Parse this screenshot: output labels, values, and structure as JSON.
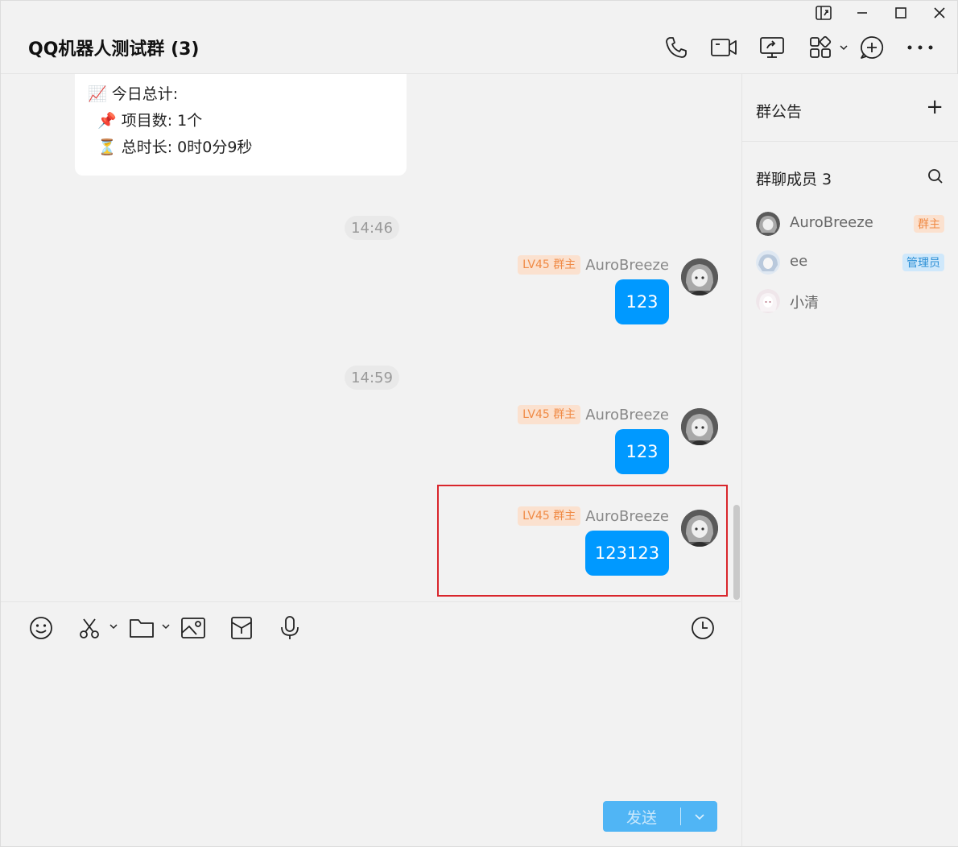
{
  "header": {
    "title": "QQ机器人测试群 (3)"
  },
  "chat": {
    "summary": {
      "line1_emoji": "📈",
      "line1": "今日总计:",
      "line2_emoji": "📌",
      "line2": "项目数: 1个",
      "line3_emoji": "⏳",
      "line3": "总时长: 0时0分9秒"
    },
    "timestamps": [
      "14:46",
      "14:59"
    ],
    "messages": [
      {
        "badge": "LV45 群主",
        "sender": "AuroBreeze",
        "text": "123"
      },
      {
        "badge": "LV45 群主",
        "sender": "AuroBreeze",
        "text": "123"
      },
      {
        "badge": "LV45 群主",
        "sender": "AuroBreeze",
        "text": "123123"
      }
    ]
  },
  "composer": {
    "send_label": "发送"
  },
  "sidebar": {
    "announcement_title": "群公告",
    "add_symbol": "+",
    "members_title": "群聊成员 3",
    "members": [
      {
        "name": "AuroBreeze",
        "role": "群主"
      },
      {
        "name": "ee",
        "role": "管理员"
      },
      {
        "name": "小清",
        "role": ""
      }
    ]
  },
  "colors": {
    "accent": "#0099ff",
    "owner_badge_text": "#f08a45",
    "owner_badge_bg": "#fbe1cf",
    "admin_badge_text": "#2b8fd6",
    "admin_badge_bg": "#cfe8fb",
    "highlight_border": "#d9262c"
  }
}
